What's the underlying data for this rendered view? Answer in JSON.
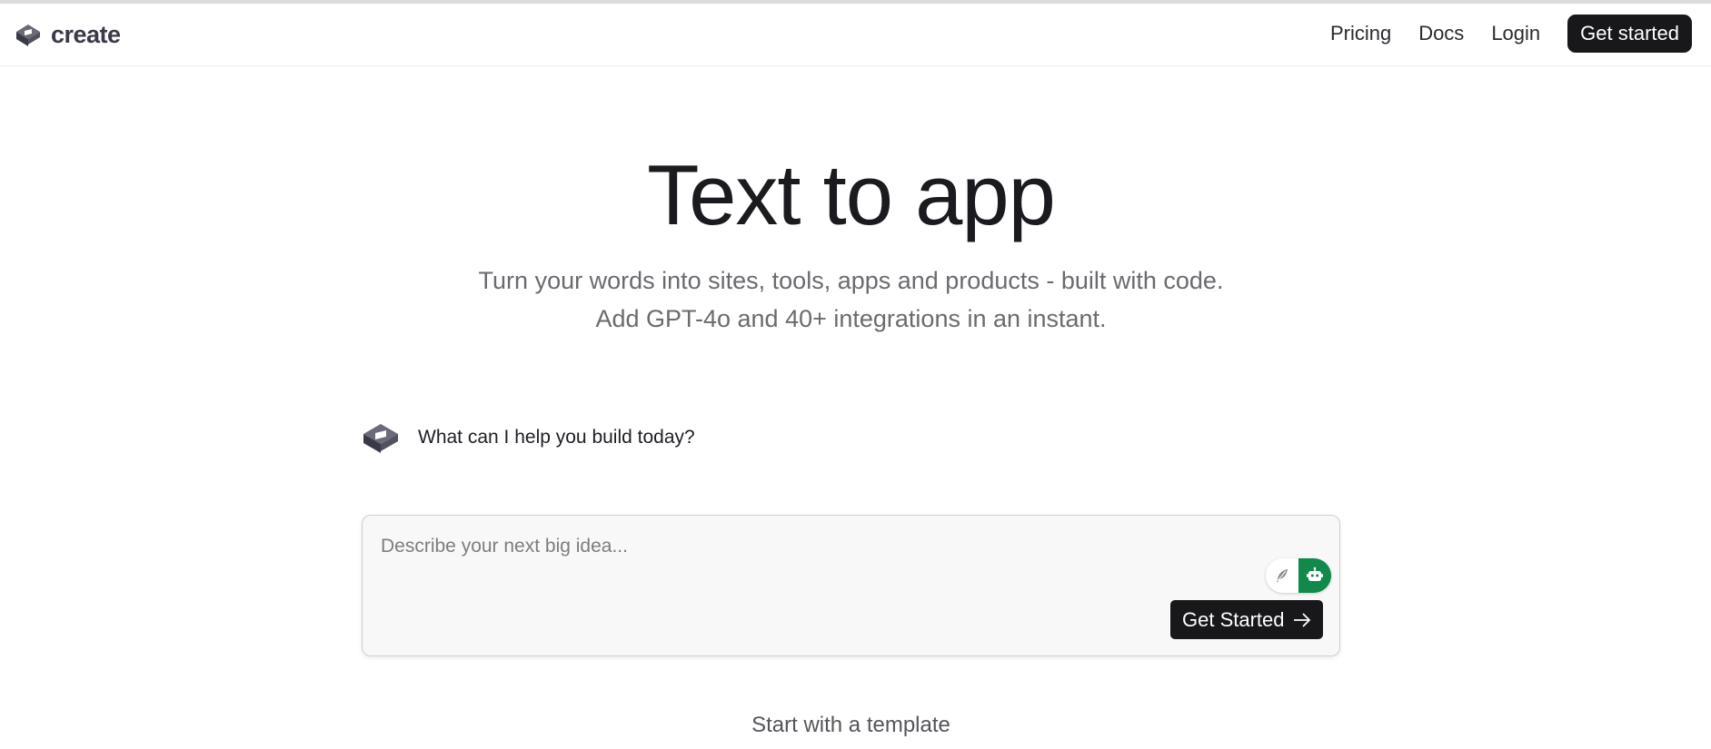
{
  "header": {
    "brand_name": "create",
    "logo_icon": "create-logo-icon",
    "nav": [
      {
        "label": "Pricing"
      },
      {
        "label": "Docs"
      },
      {
        "label": "Login"
      }
    ],
    "cta_label": "Get started"
  },
  "hero": {
    "title": "Text to app",
    "subtitle_line1": "Turn your words into sites, tools, apps and products - built with code.",
    "subtitle_line2": "Add GPT-4o and 40+ integrations in an instant."
  },
  "assistant": {
    "avatar_icon": "create-logo-icon",
    "prompt": "What can I help you build today?"
  },
  "composer": {
    "placeholder": "Describe your next big idea...",
    "value": "",
    "mode_options": [
      {
        "icon": "feather-icon",
        "selected": false
      },
      {
        "icon": "robot-icon",
        "selected": true
      }
    ],
    "submit_label": "Get Started",
    "submit_icon": "arrow-right-icon"
  },
  "templates": {
    "heading": "Start with a template"
  },
  "colors": {
    "primary_dark": "#18181b",
    "accent_green": "#10894a",
    "muted_text": "#6a6a70",
    "logo_gray": "#4a4a58"
  }
}
